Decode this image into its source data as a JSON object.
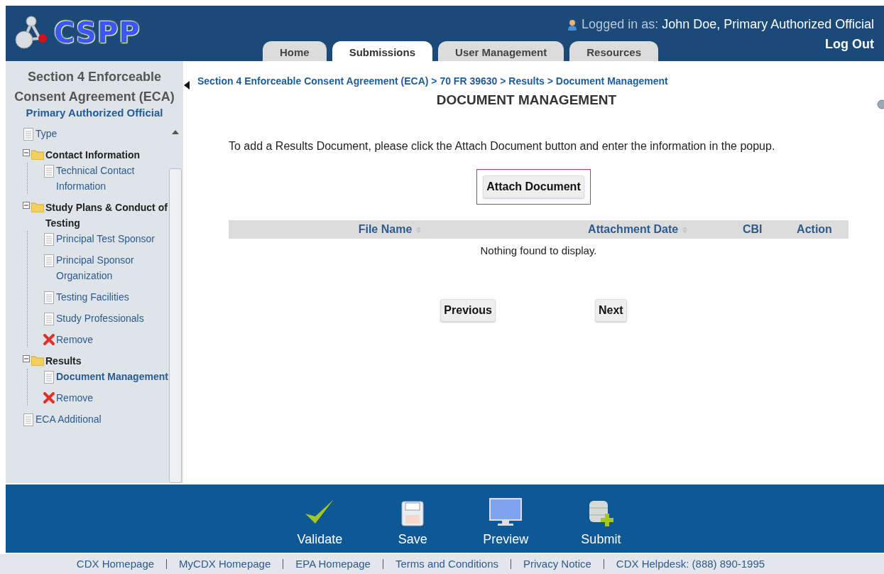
{
  "header": {
    "logo_text": "CSPP",
    "tabs": [
      {
        "label": "Home",
        "selected": false
      },
      {
        "label": "Submissions",
        "selected": true
      },
      {
        "label": "User Management",
        "selected": false
      },
      {
        "label": "Resources",
        "selected": false
      }
    ],
    "logged_in_label": "Logged in as:",
    "user": "John Doe, Primary Authorized Official",
    "logout": "Log Out"
  },
  "sidebar": {
    "title": "Section 4 Enforceable Consent Agreement (ECA)",
    "role": "Primary Authorized Official",
    "tree": [
      {
        "label": "Type",
        "kind": "page",
        "selected": false
      },
      {
        "label": "Contact Information",
        "kind": "folder",
        "expanded": true,
        "children": [
          {
            "label": "Technical Contact Information",
            "kind": "page",
            "selected": false
          }
        ]
      },
      {
        "label": "Study Plans & Conduct of Testing",
        "kind": "folder",
        "expanded": true,
        "children": [
          {
            "label": "Principal Test Sponsor",
            "kind": "page",
            "selected": false
          },
          {
            "label": "Principal Sponsor Organization",
            "kind": "page",
            "selected": false
          },
          {
            "label": "Testing Facilities",
            "kind": "page",
            "selected": false
          },
          {
            "label": "Study Professionals",
            "kind": "page",
            "selected": false
          },
          {
            "label": "Remove",
            "kind": "remove"
          }
        ]
      },
      {
        "label": "Results",
        "kind": "folder",
        "expanded": true,
        "children": [
          {
            "label": "Document Management",
            "kind": "page",
            "selected": true
          },
          {
            "label": "Remove",
            "kind": "remove"
          }
        ]
      },
      {
        "label": "ECA Additional",
        "kind": "page",
        "selected": false
      }
    ]
  },
  "breadcrumb": "Section 4 Enforceable Consent Agreement (ECA) > 70 FR 39630 > Results > Document Management",
  "page_title": "DOCUMENT MANAGEMENT",
  "instructions": "To add a Results Document, please click the Attach Document button and enter the information in the popup.",
  "attach_button": {
    "label": "Attach Document",
    "highlighted": true
  },
  "table": {
    "columns": [
      {
        "label": "File Name",
        "sortable": true
      },
      {
        "label": "Attachment Date",
        "sortable": true
      },
      {
        "label": "CBI",
        "sortable": false
      },
      {
        "label": "Action",
        "sortable": false
      }
    ],
    "empty_message": "Nothing found to display."
  },
  "pager": [
    "Previous",
    "Next"
  ],
  "actions": [
    {
      "label": "Validate",
      "kind": "validate"
    },
    {
      "label": "Save",
      "kind": "save"
    },
    {
      "label": "Preview",
      "kind": "preview"
    },
    {
      "label": "Submit",
      "kind": "submit"
    }
  ],
  "footer": [
    "CDX Homepage",
    "MyCDX Homepage",
    "EPA Homepage",
    "Terms and Conditions",
    "Privacy Notice",
    "CDX Helpdesk: (888) 890-1995"
  ]
}
